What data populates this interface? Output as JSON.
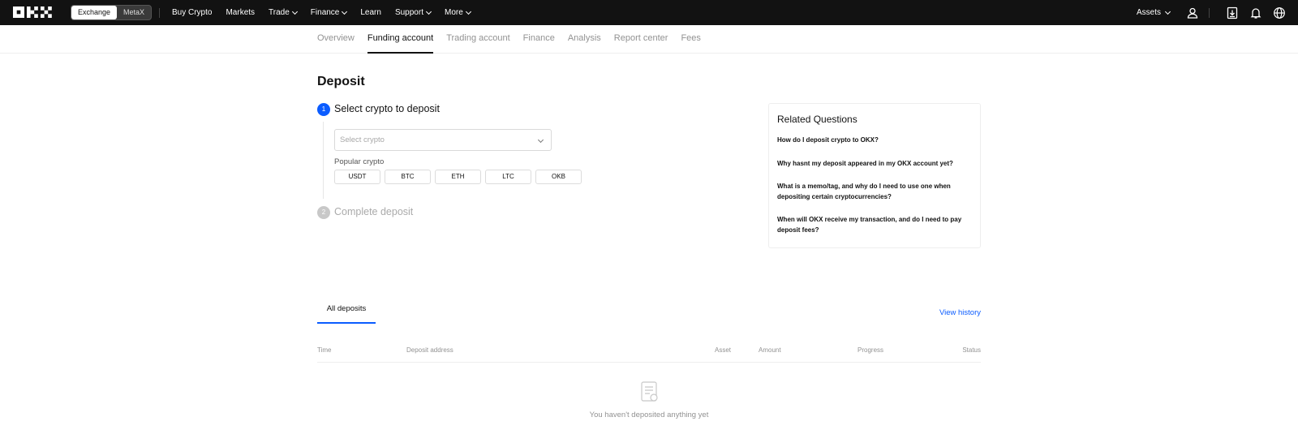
{
  "header": {
    "logo": "OKX",
    "mode_switch": {
      "exchange": "Exchange",
      "metax": "MetaX",
      "active": "Exchange"
    },
    "nav": [
      {
        "label": "Buy Crypto",
        "dropdown": false
      },
      {
        "label": "Markets",
        "dropdown": false
      },
      {
        "label": "Trade",
        "dropdown": true
      },
      {
        "label": "Finance",
        "dropdown": true
      },
      {
        "label": "Learn",
        "dropdown": false
      },
      {
        "label": "Support",
        "dropdown": true
      },
      {
        "label": "More",
        "dropdown": true
      }
    ],
    "assets_label": "Assets",
    "icons": [
      "user-icon",
      "download-icon",
      "bell-icon",
      "globe-icon"
    ]
  },
  "subnav": {
    "tabs": [
      "Overview",
      "Funding account",
      "Trading account",
      "Finance",
      "Analysis",
      "Report center",
      "Fees"
    ],
    "active": "Funding account"
  },
  "deposit": {
    "title": "Deposit",
    "step1": {
      "number": "1",
      "title": "Select crypto to deposit"
    },
    "select_placeholder": "Select crypto",
    "popular_label": "Popular crypto",
    "popular": [
      "USDT",
      "BTC",
      "ETH",
      "LTC",
      "OKB"
    ],
    "step2": {
      "number": "2",
      "title": "Complete deposit"
    }
  },
  "related": {
    "title": "Related Questions",
    "questions": [
      "How do I deposit crypto to OKX?",
      "Why hasnt my deposit appeared in my OKX account yet?",
      "What is a memo/tag, and why do I need to use one when depositing certain cryptocurrencies?",
      "When will OKX receive my transaction, and do I need to pay deposit fees?"
    ]
  },
  "deposits": {
    "tab": "All deposits",
    "view_history": "View history",
    "columns": [
      "Time",
      "Deposit address",
      "Asset",
      "Amount",
      "Progress",
      "Status"
    ],
    "empty_text": "You haven't deposited anything yet"
  },
  "colors": {
    "accent": "#0b5cff",
    "topbar": "#121212",
    "muted": "#929292"
  }
}
